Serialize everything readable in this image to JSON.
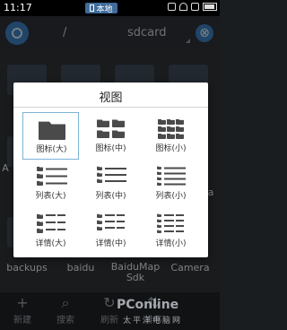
{
  "status": {
    "time": "11:17",
    "mode_chip": "本地"
  },
  "pathbar": {
    "separator": "/",
    "current_dir": "sdcard"
  },
  "background": {
    "partial_labels": [
      "A",
      "a"
    ],
    "bottom_folders": [
      "backups",
      "baidu",
      "BaiduMap Sdk",
      "Camera"
    ]
  },
  "dialog": {
    "title": "视图",
    "options": [
      {
        "label": "图标(大)",
        "icon": "folder-large-icon",
        "selected": true
      },
      {
        "label": "图标(中)",
        "icon": "folder-medium-icon",
        "selected": false
      },
      {
        "label": "图标(小)",
        "icon": "folder-small-icon",
        "selected": false
      },
      {
        "label": "列表(大)",
        "icon": "list-large-icon",
        "selected": false
      },
      {
        "label": "列表(中)",
        "icon": "list-medium-icon",
        "selected": false
      },
      {
        "label": "列表(小)",
        "icon": "list-small-icon",
        "selected": false
      },
      {
        "label": "详情(大)",
        "icon": "detail-large-icon",
        "selected": false
      },
      {
        "label": "详情(中)",
        "icon": "detail-medium-icon",
        "selected": false
      },
      {
        "label": "详情(小)",
        "icon": "detail-small-icon",
        "selected": false
      }
    ]
  },
  "toolbar": {
    "new": "新建",
    "search": "搜索",
    "refresh": "刷新",
    "sort": "排序"
  },
  "watermark": {
    "main": "PConline",
    "sub": "太平洋电脑网"
  },
  "colors": {
    "accent": "#3d7fbd",
    "selected_border": "#7ab3d8",
    "icon": "#4a4a4a"
  }
}
